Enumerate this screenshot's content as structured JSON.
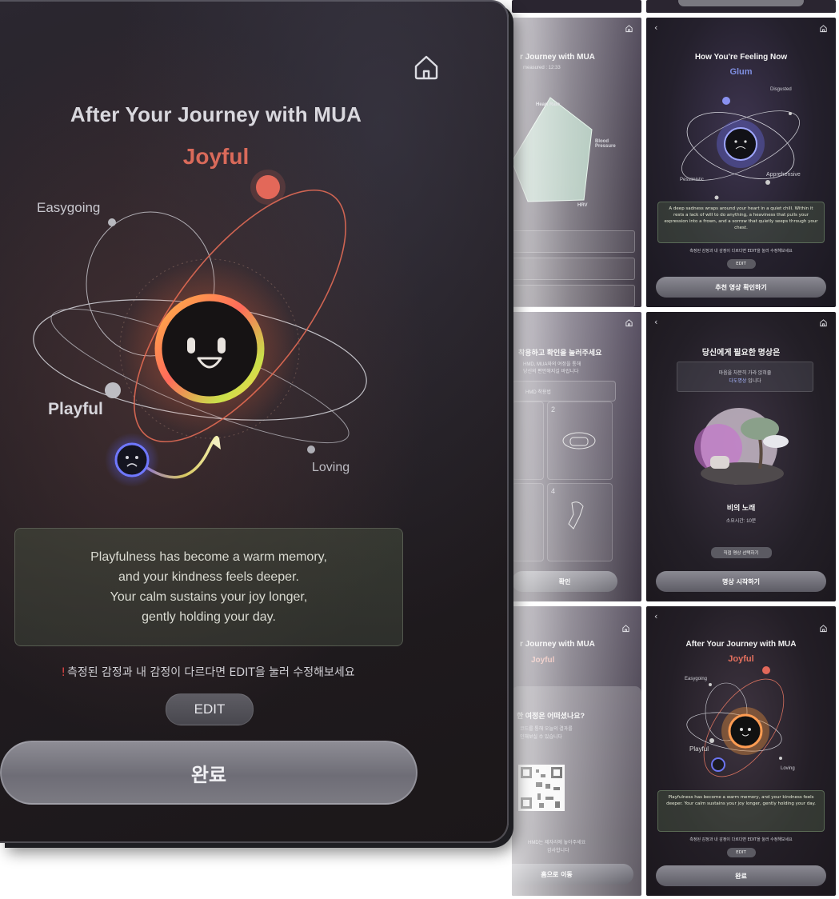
{
  "main": {
    "title": "After Your Journey with MUA",
    "current_emotion": "Joyful",
    "labels": {
      "easygoing": "Easygoing",
      "playful": "Playful",
      "loving": "Loving"
    },
    "message_lines": [
      "Playfulness has become a warm memory,",
      "and your kindness feels deeper.",
      "Your calm sustains your joy longer,",
      "gently holding your day."
    ],
    "hint_mark": "!",
    "hint": "측정된 감정과 내 감정이 다르다면 EDIT을 눌러 수정해보세요",
    "edit_label": "EDIT",
    "done_label": "완료",
    "colors": {
      "joyful": "#d96a5a",
      "accent_orbit": "#e06a55"
    }
  },
  "thumbs": {
    "journey_measure": {
      "title": "r Journey with MUA",
      "sub": "measured : 12:33",
      "radar_labels": [
        "Heart Rate",
        "Blood Pressure",
        "HRV"
      ]
    },
    "feeling_now": {
      "title": "How You're Feeling Now",
      "emotion": "Glum",
      "labels": [
        "Disgusted",
        "Pessimistic",
        "Apprehensive"
      ],
      "message": "A deep sadness wraps around your heart in a quiet chill. Within it rests a lack of will to do anything, a heaviness that pulls your expression into a frown, and a sorrow that quietly seeps through your chest.",
      "hint": "측정된 감정과 내 감정이 다르다면 EDIT을 눌러 수정해보세요",
      "edit": "EDIT",
      "button": "추천 영상 확인하기"
    },
    "hmd_guide": {
      "title": "착용하고 확인을 눌러주세요",
      "sub_1": "HMD, MUA와의 여정을 통해",
      "sub_2": "당신의 편안해지길 바랍니다",
      "tag": "HMD 착용법",
      "step_2": "2",
      "step_4": "4",
      "button": "확인"
    },
    "recommend": {
      "title": "당신에게 필요한 명상은",
      "line_1": "마음을 차분히 가라 앉혀줄",
      "line_2_a": "다도명상",
      "line_2_b": " 입니다",
      "name": "비의 노래",
      "duration": "소요시간: 10분",
      "select": "직접 명상 선택하기",
      "button": "명상 시작하기"
    },
    "journey_qr": {
      "title": "r Journey with MUA",
      "emotion": "Joyful",
      "question": "한 여정은 어떠셨나요?",
      "desc_1": "코드를 통해 오늘의 결과를",
      "desc_2": "인해보실 수 있습니다",
      "note_1": "HMD는 제자리에 놓아주세요",
      "note_2": "감사합니다",
      "button": "홈으로 이동"
    },
    "after_small": {
      "title": "After Your Journey with MUA",
      "emotion": "Joyful",
      "labels": [
        "Easygoing",
        "Playful",
        "Loving"
      ],
      "message": "Playfulness has become a warm memory, and your kindness feels deeper. Your calm sustains your joy longer, gently holding your day.",
      "hint": "측정된 감정과 내 감정이 다르다면 EDIT을 눌러 수정해보세요",
      "edit": "EDIT",
      "button": "완료"
    }
  }
}
